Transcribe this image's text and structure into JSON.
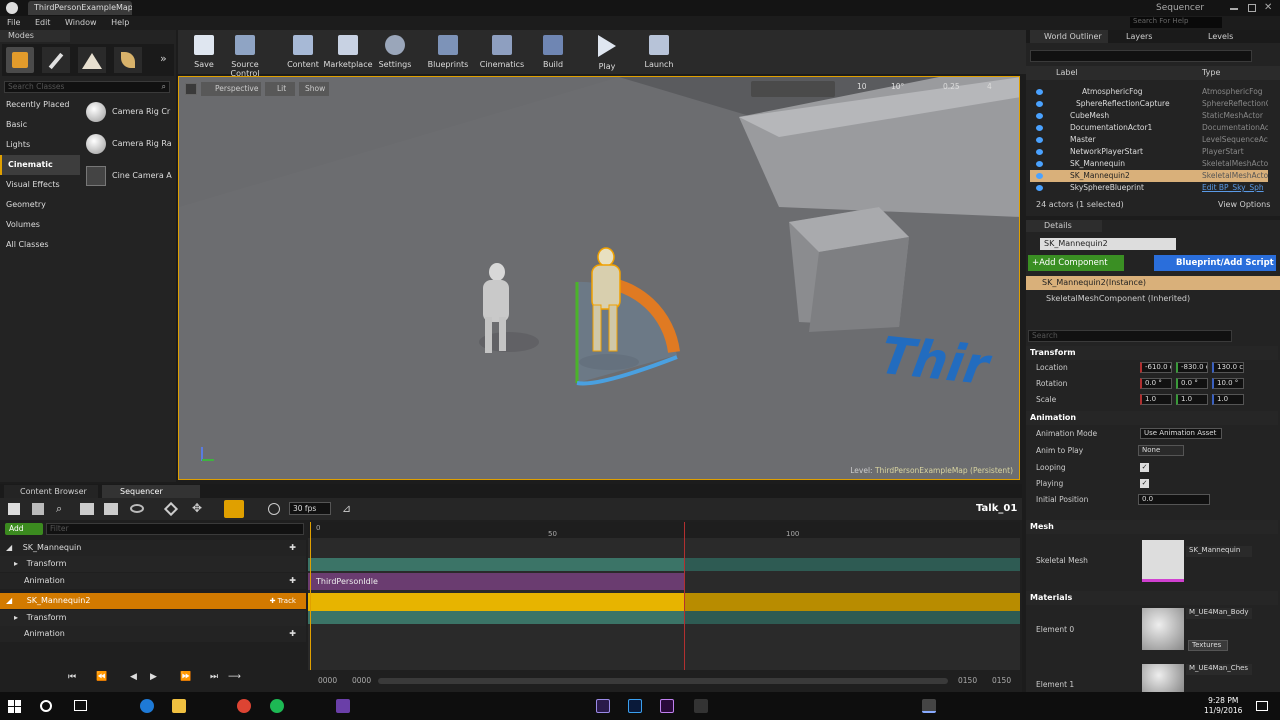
{
  "window": {
    "tab": "ThirdPersonExampleMap*",
    "right_title": "Sequencer",
    "search_help": "Search For Help"
  },
  "menu": [
    "File",
    "Edit",
    "Window",
    "Help"
  ],
  "modes": {
    "tab": "Modes",
    "search_placeholder": "Search Classes",
    "categories": [
      "Recently Placed",
      "Basic",
      "Lights",
      "Cinematic",
      "Visual Effects",
      "Geometry",
      "Volumes",
      "All Classes"
    ],
    "active_category": "Cinematic",
    "items": [
      "Camera Rig Cr",
      "Camera Rig Ra",
      "Cine Camera A"
    ]
  },
  "toolbar": [
    "Save",
    "Source Control",
    "Content",
    "Marketplace",
    "Settings",
    "Blueprints",
    "Cinematics",
    "Build",
    "Play",
    "Launch"
  ],
  "viewport": {
    "perspective": "Perspective",
    "lit": "Lit",
    "show": "Show",
    "snap_angle": "10°",
    "snap_grid": "10",
    "snap_scale": "0.25",
    "cam_speed": "4",
    "level_label": "Level:",
    "level_name": "ThirdPersonExampleMap (Persistent)",
    "floor_text": "Thir"
  },
  "bottom_tabs": [
    "Content Browser",
    "Sequencer"
  ],
  "sequencer": {
    "fps": "30 fps",
    "sequence_name": "Talk_01",
    "add_label": "Add",
    "filter_placeholder": "Filter",
    "tracks": [
      {
        "label": "SK_Mannequin",
        "level": 0
      },
      {
        "label": "Transform",
        "level": 1
      },
      {
        "label": "Animation",
        "level": 1
      },
      {
        "label": "SK_Mannequin2",
        "level": 0,
        "selected": true
      },
      {
        "label": "Transform",
        "level": 1
      },
      {
        "label": "Animation",
        "level": 1
      }
    ],
    "track_button": "Track",
    "anim_clip": "ThirdPersonIdle",
    "ruler": [
      "0",
      "50",
      "100"
    ],
    "range_start_a": "0000",
    "range_start_b": "0000",
    "range_end_a": "0150",
    "range_end_b": "0150"
  },
  "outliner": {
    "tabs": [
      "World Outliner",
      "Layers",
      "Levels"
    ],
    "col_label": "Label",
    "col_type": "Type",
    "rows": [
      {
        "label": "AtmosphericFog",
        "type": "AtmosphericFog"
      },
      {
        "label": "SphereReflectionCapture",
        "type": "SphereReflectionC"
      },
      {
        "label": "CubeMesh",
        "type": "StaticMeshActor"
      },
      {
        "label": "DocumentationActor1",
        "type": "DocumentationAc"
      },
      {
        "label": "Master",
        "type": "LevelSequenceAc"
      },
      {
        "label": "NetworkPlayerStart",
        "type": "PlayerStart"
      },
      {
        "label": "SK_Mannequin",
        "type": "SkeletalMeshActo"
      },
      {
        "label": "SK_Mannequin2",
        "type": "SkeletalMeshActo",
        "selected": true
      },
      {
        "label": "SkySphereBlueprint",
        "type": "Edit BP_Sky_Sph"
      }
    ],
    "count": "24 actors (1 selected)",
    "view_options": "View Options"
  },
  "details": {
    "tab": "Details",
    "name": "SK_Mannequin2",
    "add_component": "+Add Component",
    "blueprint_script": "Blueprint/Add Script",
    "instance": "SK_Mannequin2(Instance)",
    "component": "SkeletalMeshComponent (Inherited)",
    "search_placeholder": "Search",
    "transform_header": "Transform",
    "location_label": "Location",
    "location": [
      "-610.0 c",
      "-830.0 c",
      "130.0 cm"
    ],
    "rotation_label": "Rotation",
    "rotation": [
      "0.0 °",
      "0.0 °",
      "10.0 °"
    ],
    "scale_label": "Scale",
    "scale": [
      "1.0",
      "1.0",
      "1.0"
    ],
    "animation_header": "Animation",
    "anim_mode_label": "Animation Mode",
    "anim_mode": "Use Animation Asset",
    "anim_play_label": "Anim to Play",
    "anim_play": "None",
    "looping_label": "Looping",
    "playing_label": "Playing",
    "init_pos_label": "Initial Position",
    "init_pos": "0.0",
    "mesh_header": "Mesh",
    "skeletal_mesh_label": "Skeletal Mesh",
    "skeletal_mesh": "SK_Mannequin",
    "materials_header": "Materials",
    "element0_label": "Element 0",
    "element0": "M_UE4Man_Body",
    "textures": "Textures",
    "element1_label": "Element 1",
    "element1": "M_UE4Man_Ches"
  },
  "clock": {
    "time": "9:28 PM",
    "date": "11/9/2016"
  },
  "colors": {
    "accent": "#e08a00",
    "selected": "#d9b07a",
    "green": "#3ea400",
    "blue": "#2a6edb"
  }
}
